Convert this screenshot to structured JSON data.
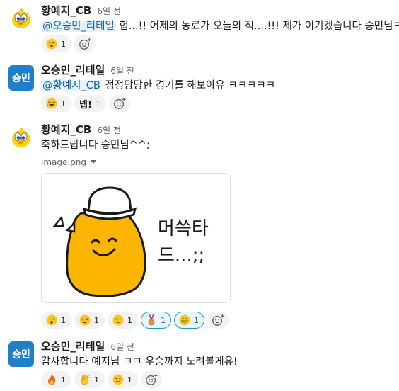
{
  "messages": [
    {
      "author": "황예지_CB",
      "time": "6일 전",
      "avatar": "tweety-avatar",
      "mention": "@오승민_리테일",
      "text": " 헙...!! 어제의 동료가 오늘의 적....!!! 제가 이기겠습니다 승민님ㅋ",
      "reactions": [
        {
          "emoji": "hushed-face",
          "count": "1"
        }
      ]
    },
    {
      "author": "오승민_리테일",
      "time": "6일 전",
      "avatar_text": "승민",
      "mention": "@황예지_CB",
      "text": " 정정당당한 경기를 해보아유 ㅋㅋㅋㅋㅋ",
      "reactions": [
        {
          "emoji": "rofl-face",
          "count": "1"
        },
        {
          "label": "넵!",
          "count": "1"
        }
      ]
    },
    {
      "author": "황예지_CB",
      "time": "6일 전",
      "avatar": "tweety-avatar",
      "text": "축하드립니다 승민님^^;",
      "file_name": "image.png",
      "image_caption": [
        "머쓱타",
        "드...;;"
      ],
      "reactions": [
        {
          "emoji": "hushed-face",
          "count": "1"
        },
        {
          "emoji": "star-struck",
          "count": "1"
        },
        {
          "emoji": "slightly-smiling-face",
          "count": "1"
        },
        {
          "emoji": "bronze-medal",
          "count": "1",
          "active": true
        },
        {
          "emoji": "grinning-face",
          "count": "1",
          "active": true
        }
      ]
    },
    {
      "author": "오승민_리테일",
      "time": "6일 전",
      "avatar_text": "승민",
      "text": "감사합니다 예지님 ㅋㅋ 우승까지 노려볼게유!",
      "reactions": [
        {
          "emoji": "fire",
          "count": "1"
        },
        {
          "emoji": "clapping-hands",
          "count": "1"
        },
        {
          "emoji": "winking-face",
          "count": "1"
        }
      ]
    }
  ],
  "colors": {
    "mention": "#1264a3",
    "active_reaction_border": "#1d9bd1",
    "avatar_blue": "#1f7fc9"
  }
}
